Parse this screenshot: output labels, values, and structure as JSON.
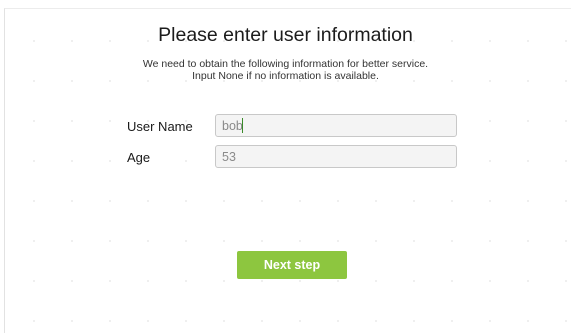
{
  "form": {
    "title": "Please enter user information",
    "subtitle_line1": "We need to obtain the following information for better service.",
    "subtitle_line2": "Input None if no information is available.",
    "fields": {
      "user_name": {
        "label": "User Name",
        "value": "bob"
      },
      "age": {
        "label": "Age",
        "value": "53"
      }
    },
    "next_button_label": "Next step"
  },
  "colors": {
    "accent": "#8dc63f",
    "caret": "#3a8a2a"
  }
}
